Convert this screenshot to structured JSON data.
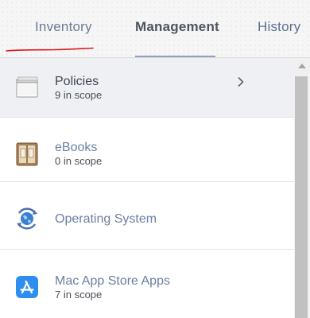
{
  "tabs": {
    "inventory": "Inventory",
    "management": "Management",
    "history": "History",
    "active": "Management"
  },
  "annotation_color": "#e0161c",
  "accent_color": "#8fa1bd",
  "items": [
    {
      "title": "Policies",
      "subtitle": "9 in scope",
      "icon": "policies-window-icon",
      "selected": true,
      "has_chevron": true
    },
    {
      "title": "eBooks",
      "subtitle": "0 in scope",
      "icon": "ebook-icon",
      "selected": false,
      "has_chevron": false
    },
    {
      "title": "Operating System",
      "subtitle": "",
      "icon": "operating-system-globe-icon",
      "selected": false,
      "has_chevron": false
    },
    {
      "title": "Mac App Store Apps",
      "subtitle": "7 in scope",
      "icon": "app-store-icon",
      "selected": false,
      "has_chevron": false
    }
  ]
}
